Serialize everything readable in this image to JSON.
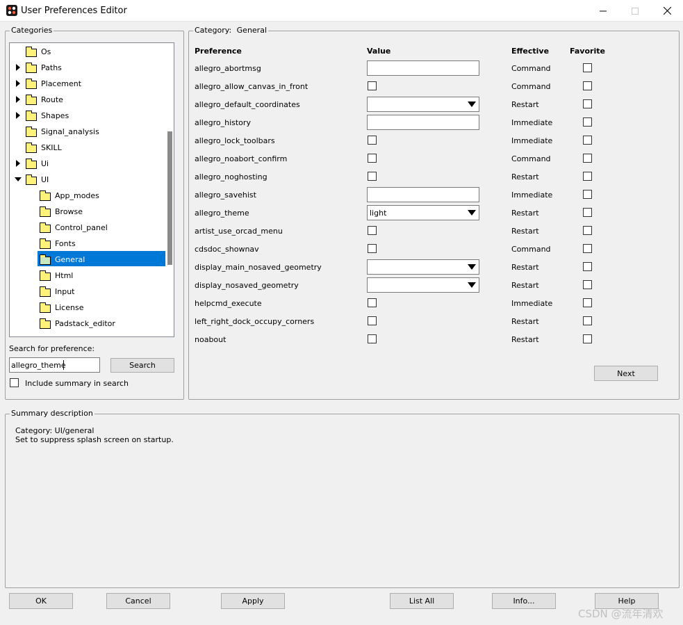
{
  "window": {
    "title": "User Preferences Editor",
    "controls": {
      "minimize": "—",
      "maximize": "☐",
      "close": "✕"
    }
  },
  "categories": {
    "legend": "Categories",
    "tree": [
      {
        "label": "Os",
        "expander": "none",
        "level": 0
      },
      {
        "label": "Paths",
        "expander": "collapsed",
        "level": 0
      },
      {
        "label": "Placement",
        "expander": "collapsed",
        "level": 0
      },
      {
        "label": "Route",
        "expander": "collapsed",
        "level": 0
      },
      {
        "label": "Shapes",
        "expander": "collapsed",
        "level": 0
      },
      {
        "label": "Signal_analysis",
        "expander": "none",
        "level": 0
      },
      {
        "label": "SKILL",
        "expander": "none",
        "level": 0
      },
      {
        "label": "Ui",
        "expander": "collapsed",
        "level": 0
      },
      {
        "label": "UI",
        "expander": "expanded",
        "level": 0
      },
      {
        "label": "App_modes",
        "expander": "none",
        "level": 1
      },
      {
        "label": "Browse",
        "expander": "none",
        "level": 1
      },
      {
        "label": "Control_panel",
        "expander": "none",
        "level": 1
      },
      {
        "label": "Fonts",
        "expander": "none",
        "level": 1
      },
      {
        "label": "General",
        "expander": "none",
        "level": 1,
        "selected": true
      },
      {
        "label": "Html",
        "expander": "none",
        "level": 1
      },
      {
        "label": "Input",
        "expander": "none",
        "level": 1
      },
      {
        "label": "License",
        "expander": "none",
        "level": 1
      },
      {
        "label": "Padstack_editor",
        "expander": "none",
        "level": 1
      }
    ],
    "search_label": "Search for preference:",
    "search_value": "allegro_theme",
    "search_button": "Search",
    "include_summary_label": "Include summary in search",
    "include_summary_checked": false
  },
  "category_panel": {
    "legend_prefix": "Category:",
    "legend_value": "General",
    "headers": {
      "preference": "Preference",
      "value": "Value",
      "effective": "Effective",
      "favorite": "Favorite"
    },
    "rows": [
      {
        "name": "allegro_abortmsg",
        "control": "text",
        "value": "",
        "effective": "Command",
        "favorite": false
      },
      {
        "name": "allegro_allow_canvas_in_front",
        "control": "checkbox",
        "value": "",
        "effective": "Command",
        "favorite": false
      },
      {
        "name": "allegro_default_coordinates",
        "control": "combo",
        "value": "",
        "effective": "Restart",
        "favorite": false
      },
      {
        "name": "allegro_history",
        "control": "text",
        "value": "",
        "effective": "Immediate",
        "favorite": false
      },
      {
        "name": "allegro_lock_toolbars",
        "control": "checkbox",
        "value": "",
        "effective": "Immediate",
        "favorite": false
      },
      {
        "name": "allegro_noabort_confirm",
        "control": "checkbox",
        "value": "",
        "effective": "Command",
        "favorite": false
      },
      {
        "name": "allegro_noghosting",
        "control": "checkbox",
        "value": "",
        "effective": "Restart",
        "favorite": false
      },
      {
        "name": "allegro_savehist",
        "control": "text",
        "value": "",
        "effective": "Immediate",
        "favorite": false
      },
      {
        "name": "allegro_theme",
        "control": "combo",
        "value": "light",
        "effective": "Restart",
        "favorite": false
      },
      {
        "name": "artist_use_orcad_menu",
        "control": "checkbox",
        "value": "",
        "effective": "Restart",
        "favorite": false
      },
      {
        "name": "cdsdoc_shownav",
        "control": "checkbox",
        "value": "",
        "effective": "Command",
        "favorite": false
      },
      {
        "name": "display_main_nosaved_geometry",
        "control": "combo",
        "value": "",
        "effective": "Restart",
        "favorite": false
      },
      {
        "name": "display_nosaved_geometry",
        "control": "combo",
        "value": "",
        "effective": "Restart",
        "favorite": false
      },
      {
        "name": "helpcmd_execute",
        "control": "checkbox",
        "value": "",
        "effective": "Immediate",
        "favorite": false
      },
      {
        "name": "left_right_dock_occupy_corners",
        "control": "checkbox",
        "value": "",
        "effective": "Restart",
        "favorite": false
      },
      {
        "name": "noabout",
        "control": "checkbox",
        "value": "",
        "effective": "Restart",
        "favorite": false
      }
    ],
    "next_button": "Next"
  },
  "summary": {
    "legend": "Summary description",
    "category_line": "Category: UI/general",
    "description": "Set to suppress splash screen on startup."
  },
  "buttons": {
    "ok": "OK",
    "cancel": "Cancel",
    "apply": "Apply",
    "list_all": "List All",
    "info": "Info...",
    "help": "Help"
  },
  "watermark": "CSDN @流年清欢"
}
